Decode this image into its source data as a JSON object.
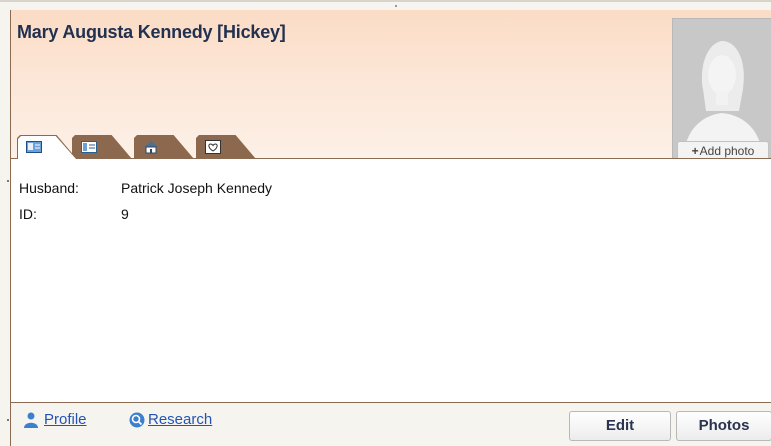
{
  "person": {
    "name": "Mary Augusta Kennedy [Hickey]",
    "add_photo_label": "Add photo"
  },
  "tabs": [
    {
      "icon": "id-card-icon",
      "active": true
    },
    {
      "icon": "details-icon",
      "active": false
    },
    {
      "icon": "house-icon",
      "active": false
    },
    {
      "icon": "heart-image-icon",
      "active": false
    }
  ],
  "details": {
    "husband_label": "Husband:",
    "husband_value": "Patrick Joseph Kennedy",
    "id_label": "ID:",
    "id_value": "9"
  },
  "footer": {
    "profile_label": "Profile",
    "research_label": "Research",
    "edit_label": "Edit",
    "photos_label": "Photos"
  },
  "colors": {
    "header_gradient_top": "#fbdcc5",
    "header_gradient_bottom": "#fdf0e6",
    "name_text": "#22314f",
    "tab_brown": "#8a6a50",
    "link_blue": "#2354b5"
  }
}
